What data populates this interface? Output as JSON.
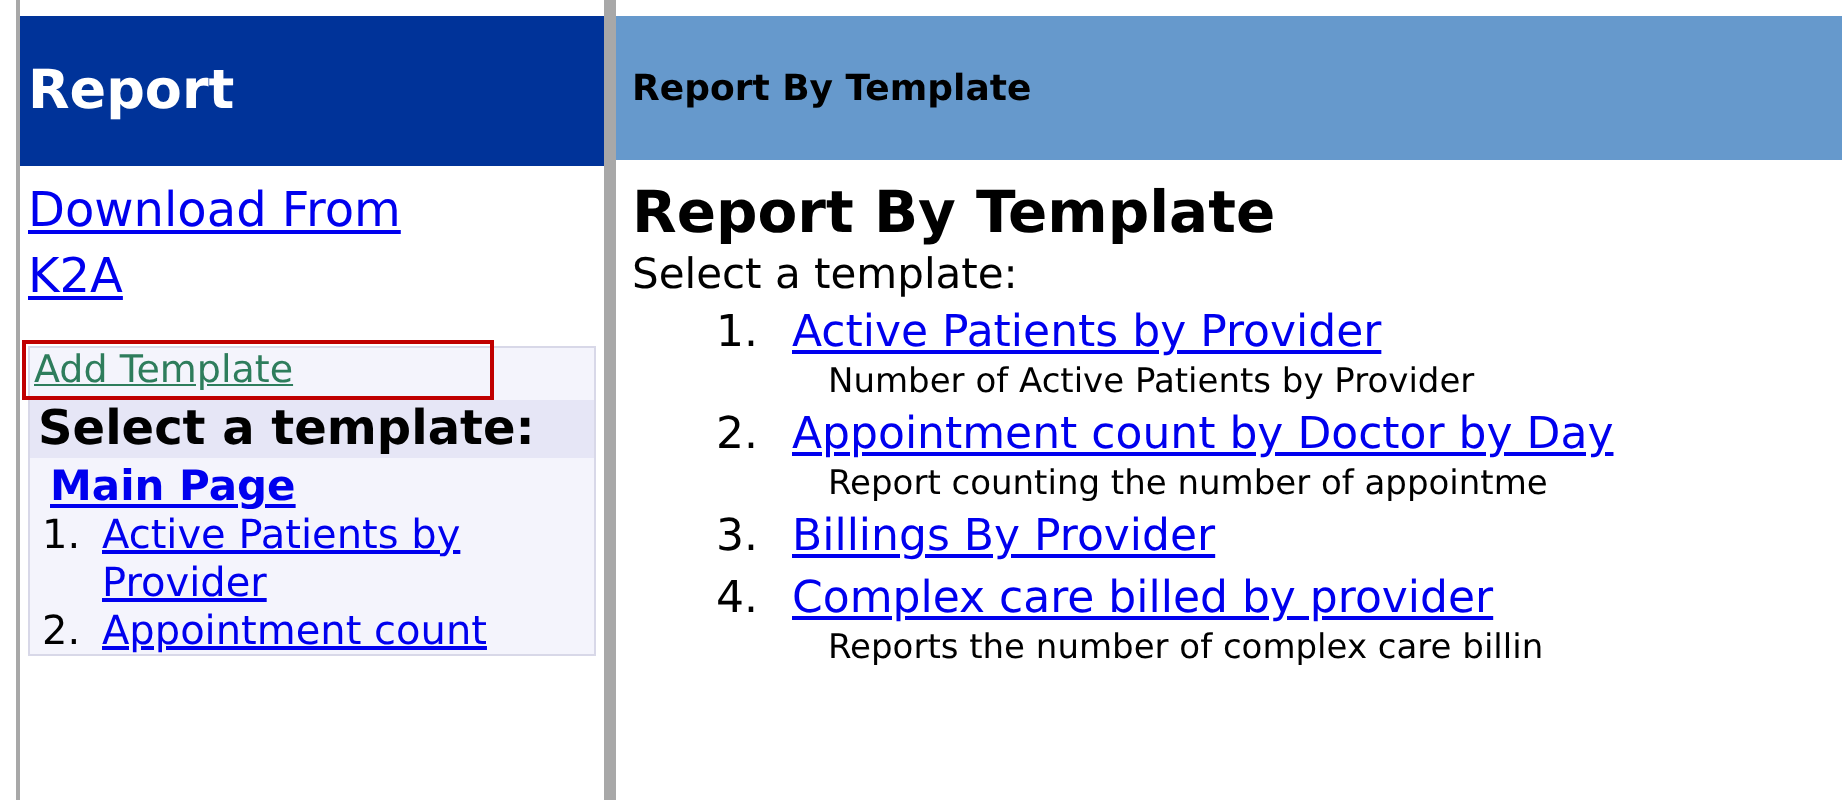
{
  "sidebar": {
    "title": "Report",
    "download_link": "Download From K2A",
    "add_template_link": "Add Template",
    "add_template_highlighted": true,
    "select_heading": "Select a template:",
    "main_page_link": "Main Page",
    "items": [
      {
        "number": "1.",
        "label": "Active Patients by Provider"
      },
      {
        "number": "2.",
        "label": "Appointment count"
      }
    ]
  },
  "main": {
    "header": "Report By Template",
    "title": "Report By Template",
    "intro": "Select a template:",
    "templates": [
      {
        "number": "1.",
        "label": "Active Patients by Provider",
        "description": "Number of Active Patients by Provider"
      },
      {
        "number": "2.",
        "label": "Appointment count by Doctor by Day",
        "description": "Report counting the number of appointme"
      },
      {
        "number": "3.",
        "label": "Billings By Provider"
      },
      {
        "number": "4.",
        "label": "Complex care billed by provider",
        "description": "Reports the number of complex care billin"
      }
    ]
  }
}
